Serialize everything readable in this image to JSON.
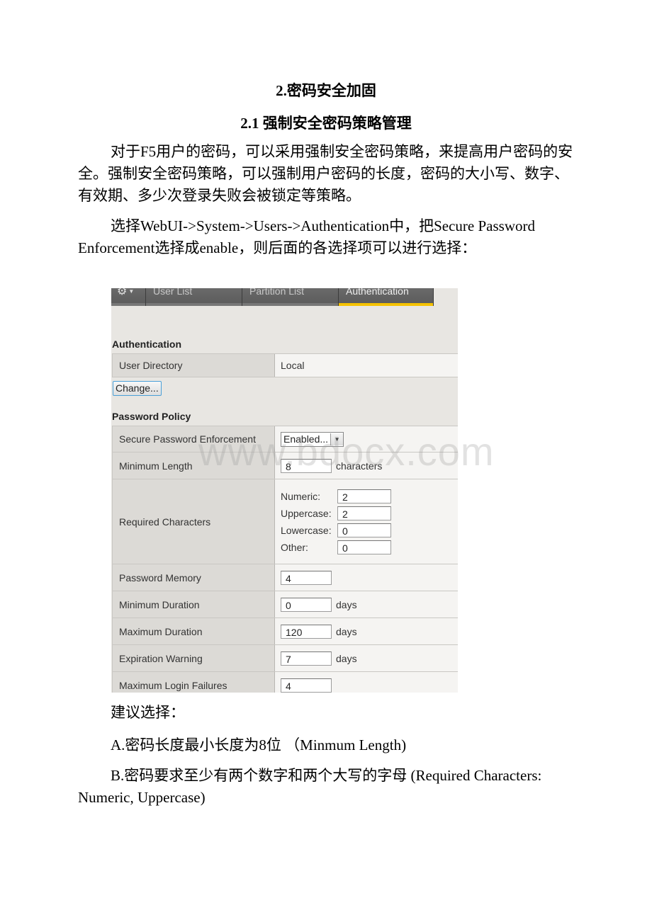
{
  "heading1": "2.密码安全加固",
  "heading2": "2.1 强制安全密码策略管理",
  "paragraph1": "对于F5用户的密码，可以采用强制安全密码策略，来提高用户密码的安全。强制安全密码策略，可以强制用户密码的长度，密码的大小写、数字、有效期、多少次登录失败会被锁定等策略。",
  "paragraph2": "选择WebUI->System->Users->Authentication中，把Secure Password Enforcement选择成enable，则后面的各选择项可以进行选择：",
  "screenshot": {
    "tabs": [
      {
        "label": "User List"
      },
      {
        "label": "Partition List"
      },
      {
        "label": "Authentication",
        "active": true
      }
    ],
    "accent_color": "#f5c200",
    "authentication": {
      "title": "Authentication",
      "user_directory_label": "User Directory",
      "user_directory_value": "Local",
      "change_button": "Change..."
    },
    "password_policy": {
      "title": "Password Policy",
      "secure_enforcement_label": "Secure Password Enforcement",
      "secure_enforcement_value": "Enabled...",
      "min_length_label": "Minimum Length",
      "min_length_value": "8",
      "min_length_unit": "characters",
      "required_chars_label": "Required Characters",
      "required_chars": [
        {
          "label": "Numeric:",
          "value": "2"
        },
        {
          "label": "Uppercase:",
          "value": "2"
        },
        {
          "label": "Lowercase:",
          "value": "0"
        },
        {
          "label": "Other:",
          "value": "0"
        }
      ],
      "password_memory_label": "Password Memory",
      "password_memory_value": "4",
      "min_duration_label": "Minimum Duration",
      "min_duration_value": "0",
      "max_duration_label": "Maximum Duration",
      "max_duration_value": "120",
      "expiration_warning_label": "Expiration Warning",
      "expiration_warning_value": "7",
      "days_unit": "days",
      "max_login_failures_label": "Maximum Login Failures",
      "max_login_failures_value": "4"
    }
  },
  "watermark": "www.bdocx.com",
  "recommend_title": "建议选择：",
  "recommend_a": "A.密码长度最小长度为8位 （Minmum Length)",
  "recommend_b": "B.密码要求至少有两个数字和两个大写的字母 (Required Characters: Numeric, Uppercase)"
}
